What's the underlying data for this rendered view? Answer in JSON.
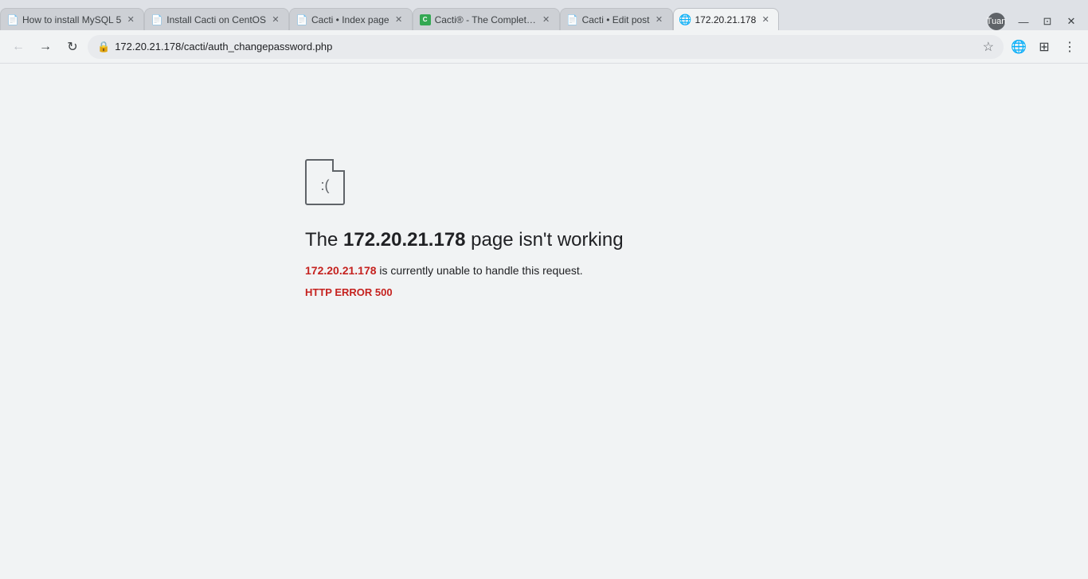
{
  "browser": {
    "tabs": [
      {
        "id": "tab1",
        "title": "How to install MySQL 5",
        "favicon_type": "doc",
        "active": false,
        "url": ""
      },
      {
        "id": "tab2",
        "title": "Install Cacti on CentOS",
        "favicon_type": "doc",
        "active": false,
        "url": ""
      },
      {
        "id": "tab3",
        "title": "Cacti • Index page",
        "favicon_type": "doc",
        "active": false,
        "url": ""
      },
      {
        "id": "tab4",
        "title": "Cacti® - The Complete...",
        "favicon_type": "green",
        "active": false,
        "url": ""
      },
      {
        "id": "tab5",
        "title": "Cacti • Edit post",
        "favicon_type": "doc",
        "active": false,
        "url": ""
      },
      {
        "id": "tab6",
        "title": "172.20.21.178",
        "favicon_type": "globe",
        "active": true,
        "url": ""
      }
    ],
    "address": "172.20.21.178/cacti/auth_changepassword.php",
    "user": "Tuan"
  },
  "error": {
    "title_prefix": "The ",
    "title_ip": "172.20.21.178",
    "title_suffix": " page isn't working",
    "subtitle_ip": "172.20.21.178",
    "subtitle_text": " is currently unable to handle this request.",
    "error_code": "HTTP ERROR 500"
  },
  "icons": {
    "back": "←",
    "forward": "→",
    "refresh": "↻",
    "lock": "🔒",
    "star": "☆",
    "globe": "🌐",
    "extensions": "⊞",
    "menu": "⋮",
    "minimize": "—",
    "maximize": "⊡",
    "close": "✕"
  }
}
